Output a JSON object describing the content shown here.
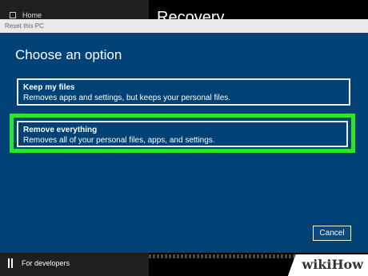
{
  "background": {
    "nav_home": "Home",
    "recovery_title": "Recovery",
    "dev_label": "For developers",
    "dev_icon": "developer-icon"
  },
  "dialog": {
    "title": "Reset this PC",
    "heading": "Choose an option",
    "options": [
      {
        "title": "Keep my files",
        "description": "Removes apps and settings, but keeps your personal files."
      },
      {
        "title": "Remove everything",
        "description": "Removes all of your personal files, apps, and settings.",
        "highlighted": true,
        "highlight_color": "#2ee52e"
      }
    ],
    "cancel_label": "Cancel",
    "bg_color": "#004275"
  },
  "watermark": {
    "text": "wikiHow"
  }
}
